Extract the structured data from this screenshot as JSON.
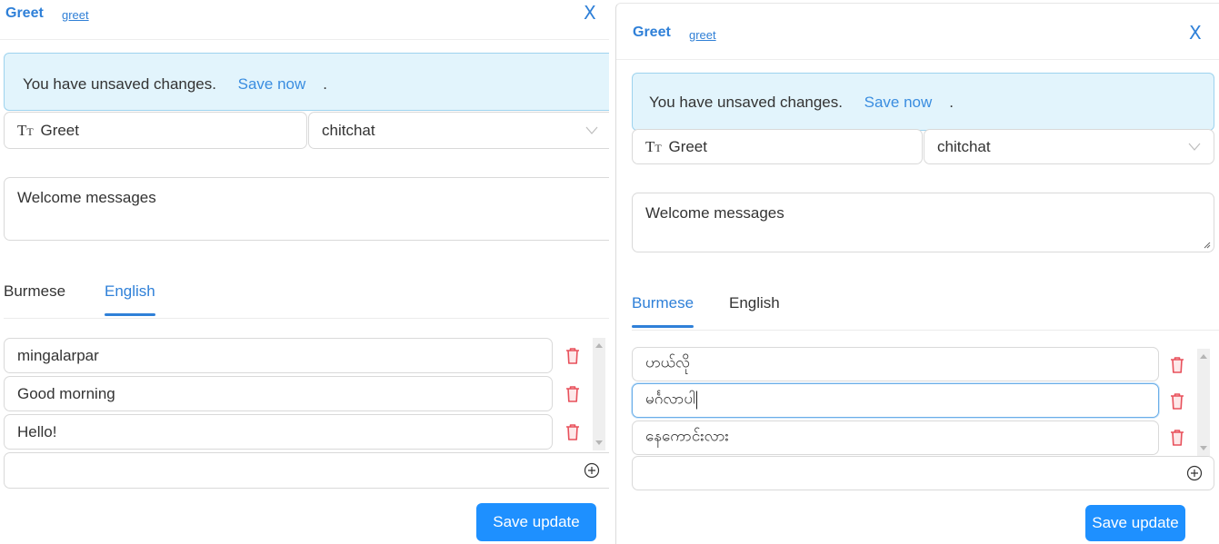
{
  "colors": {
    "accent": "#2f80d8",
    "alert_bg": "#e2f4fc",
    "alert_border": "#9ed3ee",
    "danger": "#e8505b",
    "primary_button": "#1e90ff"
  },
  "panels": [
    {
      "header": {
        "title": "Greet",
        "slug_link": "greet",
        "close_label": "X"
      },
      "alert": {
        "message": "You have unsaved changes.",
        "action_label": "Save now",
        "suffix": "."
      },
      "name_field": {
        "icon": "text-type-icon",
        "icon_text": "Tт",
        "value": "Greet"
      },
      "category_select": {
        "value": "chitchat"
      },
      "description": {
        "value": "Welcome messages"
      },
      "tabs": [
        {
          "label": "Burmese",
          "active": false
        },
        {
          "label": "English",
          "active": true
        }
      ],
      "phrases": [
        {
          "value": "mingalarpar",
          "focused": false
        },
        {
          "value": "Good morning",
          "focused": false
        },
        {
          "value": "Hello!",
          "focused": false
        }
      ],
      "new_phrase": {
        "value": ""
      },
      "save_label": "Save update"
    },
    {
      "header": {
        "title": "Greet",
        "slug_link": "greet",
        "close_label": "X"
      },
      "alert": {
        "message": "You have unsaved changes.",
        "action_label": "Save now",
        "suffix": "."
      },
      "name_field": {
        "icon": "text-type-icon",
        "icon_text": "Tт",
        "value": "Greet"
      },
      "category_select": {
        "value": "chitchat"
      },
      "description": {
        "value": "Welcome messages"
      },
      "tabs": [
        {
          "label": "Burmese",
          "active": true
        },
        {
          "label": "English",
          "active": false
        }
      ],
      "phrases": [
        {
          "value": "ဟယ်လို",
          "focused": false
        },
        {
          "value": "မင်္ဂလာပါ",
          "focused": true
        },
        {
          "value": "နေကောင်းလား",
          "focused": false
        }
      ],
      "new_phrase": {
        "value": ""
      },
      "save_label": "Save update"
    }
  ]
}
